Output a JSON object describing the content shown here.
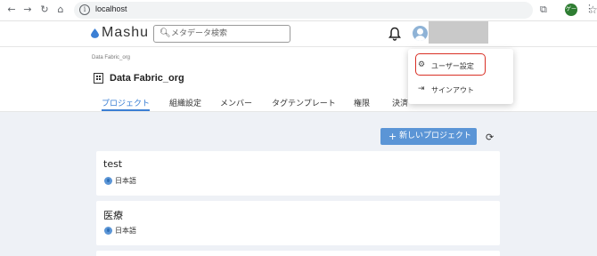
{
  "browser": {
    "url": "localhost",
    "profile_initials": "ゲー",
    "icons": [
      "back-arrow-icon",
      "forward-arrow-icon",
      "reload-icon",
      "home-icon",
      "site-info-icon",
      "key-icon",
      "star-icon",
      "extensions-icon",
      "menu-kebab-icon"
    ]
  },
  "header": {
    "logo": "Mashu",
    "search_placeholder": "メタデータ検索",
    "brand_color": "#3b7fd4"
  },
  "org": {
    "breadcrumb": "Data Fabric_org",
    "title": "Data Fabric_org",
    "tabs": [
      {
        "label": "プロジェクト",
        "active": true
      },
      {
        "label": "組織設定",
        "active": false
      },
      {
        "label": "メンバー",
        "active": false
      },
      {
        "label": "タグテンプレート",
        "active": false
      },
      {
        "label": "権限",
        "active": false
      },
      {
        "label": "決済",
        "active": false
      }
    ]
  },
  "actions": {
    "new_project": "新しいプロジェクト"
  },
  "projects": [
    {
      "name": "test",
      "language": "日本語"
    },
    {
      "name": "医療",
      "language": "日本語"
    }
  ],
  "user_menu": {
    "items": [
      {
        "label": "ユーザー設定",
        "icon": "gear-icon",
        "highlighted": true
      },
      {
        "label": "サインアウト",
        "icon": "sign-out-icon",
        "highlighted": false
      }
    ],
    "highlight_color": "#d93025"
  }
}
